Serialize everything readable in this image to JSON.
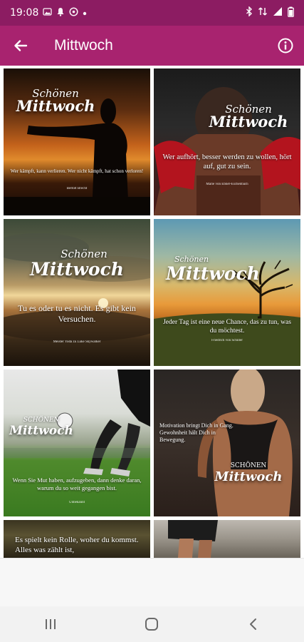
{
  "status_bar": {
    "time": "19:08"
  },
  "app_bar": {
    "title": "Mittwoch"
  },
  "tiles": [
    {
      "cap1": "Schönen",
      "cap2": "Mittwoch",
      "quote": "Wer kämpft, kann verlieren. Wer nicht kämpft, hat schon verloren!",
      "author": "Bertolt Brecht"
    },
    {
      "cap1": "Schönen",
      "cap2": "Mittwoch",
      "quote": "Wer aufhört, besser werden zu wollen, hört auf, gut zu sein.",
      "author": "Marie von Ebner-Eschenbach"
    },
    {
      "cap1": "Schönen",
      "cap2": "Mittwoch",
      "quote": "Tu es oder tu es nicht. Es gibt kein Versuchen.",
      "author": "Meister Yoda zu Luke Skywalker"
    },
    {
      "cap1": "Schönen",
      "cap2": "Mittwoch",
      "quote": "Jeder Tag ist eine neue Chance, das zu tun, was du möchtest.",
      "author": "Friedrich von Schiller"
    },
    {
      "cap1": "SCHÖNEN",
      "cap2": "Mittwoch",
      "quote": "Wenn Sie Mut haben, aufzugeben, dann denke daran, warum du so weit gegangen bist.",
      "author": "Unbekannt"
    },
    {
      "cap1": "SCHÖNEN",
      "cap2": "Mittwoch",
      "quote": "Motivation bringt Dich in Gang. Gewohnheit hält Dich in Bewegung.",
      "author": ""
    },
    {
      "cap1": "",
      "cap2": "",
      "quote": "Es spielt kein Rolle, woher du kommst. Alles was zählt ist,",
      "author": ""
    },
    {
      "cap1": "",
      "cap2": "",
      "quote": "",
      "author": ""
    }
  ],
  "icons": {
    "back": "arrow-left-icon",
    "info": "info-circle-icon",
    "nav_recents": "recents-icon",
    "nav_home": "home-icon",
    "nav_back": "nav-back-icon"
  },
  "colors": {
    "status_bar": "#8c1c62",
    "app_bar": "#a8236f"
  }
}
